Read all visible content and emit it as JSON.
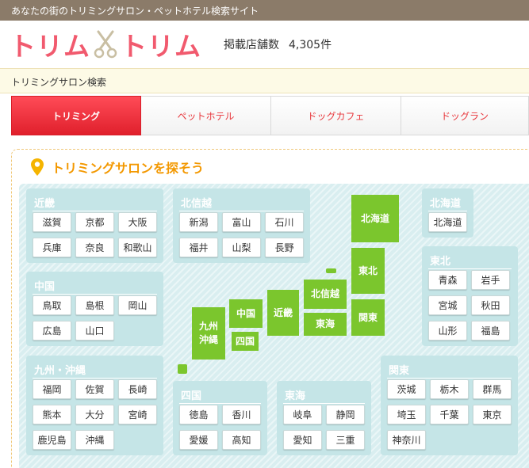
{
  "topbar": {
    "tagline": "あなたの街のトリミングサロン・ペットホテル検索サイト"
  },
  "header": {
    "logo_left": "トリム",
    "logo_right": "トリム",
    "count_label": "掲載店舗数",
    "count_value": "4,305件"
  },
  "breadcrumb": {
    "text": "トリミングサロン検索"
  },
  "tabs": [
    {
      "label": "トリミング"
    },
    {
      "label": "ペットホテル"
    },
    {
      "label": "ドッグカフェ"
    },
    {
      "label": "ドッグラン"
    }
  ],
  "search": {
    "title": "トリミングサロンを探そう"
  },
  "regions": {
    "kinki": {
      "title": "近畿",
      "prefs": [
        "滋賀",
        "京都",
        "大阪",
        "兵庫",
        "奈良",
        "和歌山"
      ]
    },
    "hokushinetsu": {
      "title": "北信越",
      "prefs": [
        "新潟",
        "富山",
        "石川",
        "福井",
        "山梨",
        "長野"
      ]
    },
    "hokkaido": {
      "title": "北海道",
      "prefs": [
        "北海道"
      ]
    },
    "tohoku": {
      "title": "東北",
      "prefs": [
        "青森",
        "岩手",
        "宮城",
        "秋田",
        "山形",
        "福島"
      ]
    },
    "chugoku": {
      "title": "中国",
      "prefs": [
        "鳥取",
        "島根",
        "岡山",
        "広島",
        "山口"
      ]
    },
    "kyushu": {
      "title": "九州・沖縄",
      "prefs": [
        "福岡",
        "佐賀",
        "長崎",
        "熊本",
        "大分",
        "宮崎",
        "鹿児島",
        "沖縄"
      ]
    },
    "shikoku": {
      "title": "四国",
      "prefs": [
        "徳島",
        "香川",
        "愛媛",
        "高知"
      ]
    },
    "tokai": {
      "title": "東海",
      "prefs": [
        "岐阜",
        "静岡",
        "愛知",
        "三重"
      ]
    },
    "kanto": {
      "title": "関東",
      "prefs": [
        "茨城",
        "栃木",
        "群馬",
        "埼玉",
        "千葉",
        "東京",
        "神奈川"
      ]
    }
  },
  "map": {
    "hokkaido": "北海道",
    "tohoku": "東北",
    "hokushinetsu": "北信越",
    "kanto": "関東",
    "tokai": "東海",
    "kinki": "近畿",
    "chugoku": "中国",
    "shikoku": "四国",
    "kyushu_line1": "九州",
    "kyushu_line2": "沖縄"
  },
  "colors": {
    "brand": "#f15a6e",
    "accent": "#f39800",
    "map_green": "#7bc62d",
    "region_bg": "#c5e5e7"
  }
}
